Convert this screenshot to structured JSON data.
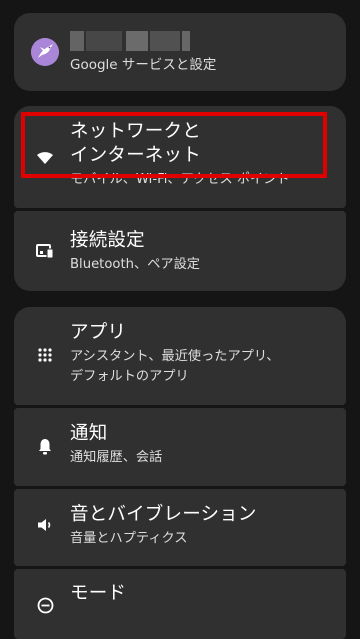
{
  "account": {
    "subtitle": "Google サービスと設定",
    "avatar_icon": "hummingbird-avatar-icon"
  },
  "items": {
    "network": {
      "title": "ネットワークと\nインターネット",
      "subtitle": "モバイル、Wi-Fi、アクセス ポイント",
      "icon": "wifi-icon"
    },
    "connections": {
      "title": "接続設定",
      "subtitle": "Bluetooth、ペア設定",
      "icon": "connected-devices-icon"
    },
    "apps": {
      "title": "アプリ",
      "subtitle": "アシスタント、最近使ったアプリ、\nデフォルトのアプリ",
      "icon": "apps-grid-icon"
    },
    "notifications": {
      "title": "通知",
      "subtitle": "通知履歴、会話",
      "icon": "bell-icon"
    },
    "sound": {
      "title": "音とバイブレーション",
      "subtitle": "音量とハプティクス",
      "icon": "speaker-icon"
    },
    "modes": {
      "title": "モード",
      "icon": "do-not-disturb-icon"
    }
  },
  "colors": {
    "background": "#151515",
    "card": "#303030",
    "highlight": "#e00000",
    "avatar": "#a986d8"
  }
}
